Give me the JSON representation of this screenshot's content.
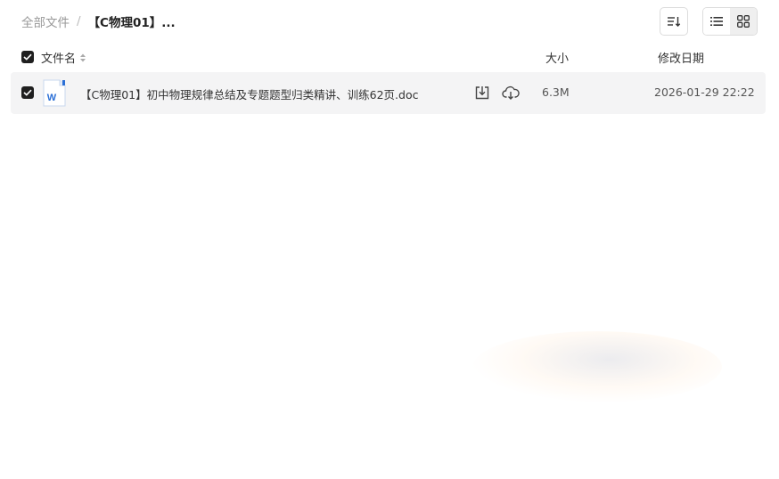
{
  "breadcrumb": {
    "root": "全部文件",
    "separator": "/",
    "current": "【C物理01】..."
  },
  "toolbar": {
    "sort_icon": "sort-icon",
    "list_view_icon": "list-view-icon",
    "grid_view_icon": "grid-view-icon",
    "active_view": "list"
  },
  "table": {
    "headers": {
      "name": "文件名",
      "size": "大小",
      "modified": "修改日期"
    },
    "header_checked": true,
    "rows": [
      {
        "checked": true,
        "icon": "word-doc-icon",
        "name": "【C物理01】初中物理规律总结及专题题型归类精讲、训练62页.doc",
        "size": "6.3M",
        "modified": "2026-01-29 22:22",
        "actions": [
          "download-icon",
          "cloud-save-icon"
        ]
      }
    ]
  },
  "colors": {
    "row_highlight": "#f4f4f5",
    "checkbox": "#1f1f1f",
    "word_blue": "#2b6fd6"
  }
}
